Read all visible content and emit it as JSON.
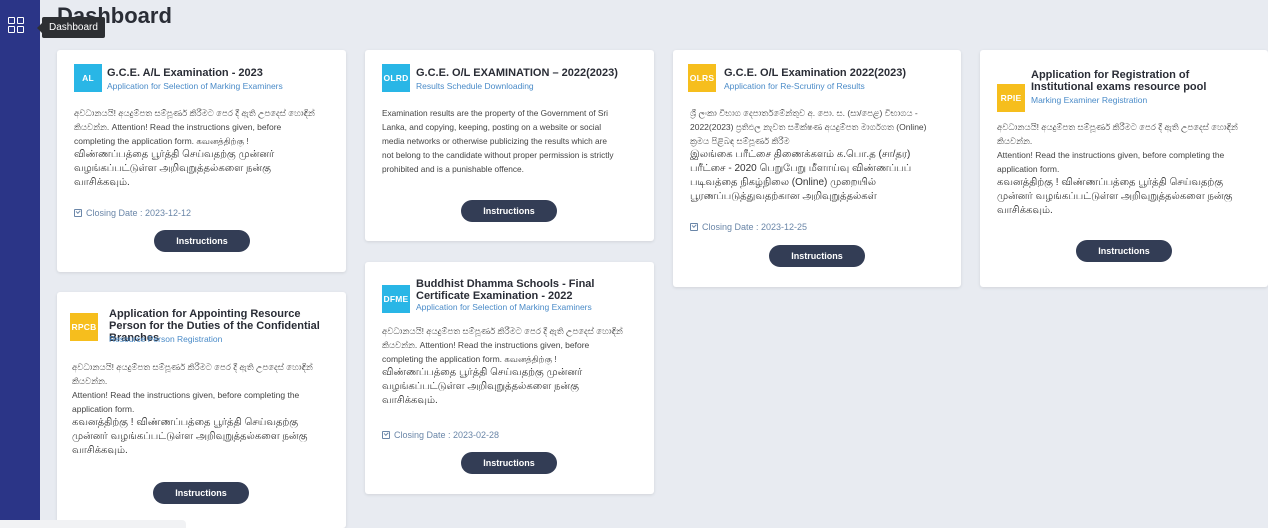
{
  "tooltip": "Dashboard",
  "page_title": "Dashboard",
  "cards": [
    {
      "badge": "AL",
      "badge_color": "#29b6e6",
      "title": "G.C.E. A/L Examination - 2023",
      "subtitle": "Application for Selection of Marking Examiners",
      "body": [
        "අවධානයයි! අයදුම්පත සම්පූර්ණ කිරීමට පෙර දී ඇති උපදෙස් හොඳින්",
        "කියවන්න. Attention! Read the instructions given, before",
        "completing the application form. கவனத்திற்கு !",
        "விண்ணப்பத்தை பூர்த்தி செய்வதற்கு முன்னர்",
        "வழங்கப்பட்டுள்ள அறிவுறுத்தல்களை நன்கு",
        "வாசிக்கவும்."
      ],
      "closing": "Closing Date : 2023-12-12",
      "button": "Instructions"
    },
    {
      "badge": "OLRD",
      "badge_color": "#29b6e6",
      "title": "G.C.E. O/L EXAMINATION – 2022(2023)",
      "subtitle": "Results Schedule Downloading",
      "body": [
        "Examination results are the property of the Government of Sri",
        "Lanka, and copying, keeping, posting on a website or social",
        "media networks or otherwise publicizing the results which are",
        "not belong to the candidate without proper permission is strictly",
        "prohibited and is a punishable offence."
      ],
      "button": "Instructions"
    },
    {
      "badge": "OLRS",
      "badge_color": "#f6be1d",
      "title": "G.C.E. O/L Examination 2022(2023)",
      "subtitle": "Application for Re-Scrutiny of Results",
      "body": [
        "ශ්‍රී ලංකා විභාග දෙපාර්තමේන්තුව අ. පො. ස. (සා/පෙළ) විභාගය -",
        "2022(2023) ප්‍රතිඵල නැවත සමීක්ෂණ අයදුම්පත මාර්ගගත (Online)",
        "ක්‍රමය පිළිබඳ සම්පූර්ණ කිරීම",
        "இலங்கை பரீட்சை திணைக்களம் க.பொ.த (சா/தர)",
        "பரீட்சை - 2020 பெறுபேறு மீளாய்வு விண்ணப்பப்",
        "படிவத்தை நிகழ்நிலை (Online) முறையில்",
        "பூரணப்படுத்துவதற்கான அறிவுறுத்தல்கள்"
      ],
      "closing": "Closing Date : 2023-12-25",
      "button": "Instructions"
    },
    {
      "badge": "RPIE",
      "badge_color": "#f6be1d",
      "title": "Application for Registration of Institutional exams resource pool",
      "subtitle": "Marking Examiner Registration",
      "body": [
        "අවධානයයි! අයදුම්පත සම්පූර්ණ කිරීමට පෙර දී ඇති උපදෙස් හොඳින්",
        "කියවන්න.",
        "Attention! Read the instructions given, before completing the",
        "application form.",
        "கவனத்திற்கு ! விண்ணப்பத்தை பூர்த்தி செய்வதற்கு",
        "முன்னர் வழங்கப்பட்டுள்ள அறிவுறுத்தல்களை நன்கு",
        "வாசிக்கவும்."
      ],
      "button": "Instructions"
    },
    {
      "badge": "DFME",
      "badge_color": "#29b6e6",
      "title": "Buddhist Dhamma Schools - Final Certificate Examination - 2022",
      "subtitle": "Application for Selection of Marking Examiners",
      "body": [
        "අවධානයයි! අයදුම්පත සම්පූර්ණ කිරීමට පෙර දී ඇති උපදෙස් හොඳින්",
        "කියවන්න. Attention! Read the instructions given, before",
        "completing the application form. கவனத்திற்கு !",
        "விண்ணப்பத்தை பூர்த்தி செய்வதற்கு முன்னர்",
        "வழங்கப்பட்டுள்ள அறிவுறுத்தல்களை நன்கு",
        "வாசிக்கவும்."
      ],
      "closing": "Closing Date : 2023-02-28",
      "button": "Instructions"
    },
    {
      "badge": "RPCB",
      "badge_color": "#f6be1d",
      "title": "Application for Appointing Resource Person for the Duties of the Confidential Branches",
      "subtitle": "Resource Person Registration",
      "body": [
        "අවධානයයි! අයදුම්පත සම්පූර්ණ කිරීමට පෙර දී ඇති උපදෙස් හොඳින්",
        "කියවන්න.",
        "Attention! Read the instructions given, before completing the",
        "application form.",
        "கவனத்திற்கு ! விண்ணப்பத்தை பூர்த்தி செய்வதற்கு",
        "முன்னர் வழங்கப்பட்டுள்ள அறிவுறுத்தல்களை நன்கு",
        "வாசிக்கவும்."
      ],
      "button": "Instructions"
    }
  ]
}
